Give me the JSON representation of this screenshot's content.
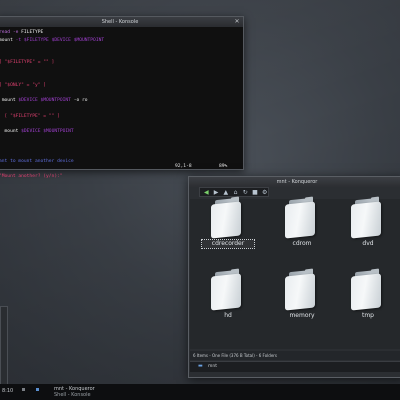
{
  "konsole": {
    "title": "Shell - Konsole",
    "lines": [
      [
        {
          "t": "read -e ",
          "c": "c-kw"
        },
        {
          "t": "FILETYPE",
          "c": "c-w"
        }
      ],
      [
        {
          "t": "mount ",
          "c": "c-w"
        },
        {
          "t": "-t $FILETYPE $DEVICE $MOUNTPOINT",
          "c": "c-var"
        }
      ],
      [],
      [],
      [
        {
          "t": "[ \"$FILETYPE\" = \"\" ]",
          "c": "c-str"
        }
      ],
      [],
      [],
      [
        {
          "t": "[ \"$ONLY\" = \"y\" ]",
          "c": "c-str"
        }
      ],
      [],
      [
        {
          "t": " mount ",
          "c": "c-w"
        },
        {
          "t": "$DEVICE $MOUNTPOINT",
          "c": "c-var"
        },
        {
          "t": " -o ro",
          "c": "c-w"
        }
      ],
      [],
      [
        {
          "t": "  [ \"$FILETYPE\" = \"\" ]",
          "c": "c-str"
        }
      ],
      [],
      [
        {
          "t": "  mount ",
          "c": "c-w"
        },
        {
          "t": "$DEVICE $MOUNTPOINT",
          "c": "c-var"
        }
      ],
      [],
      [],
      [],
      [
        {
          "t": "ant to mount another device",
          "c": "c-cmt"
        }
      ],
      [],
      [
        {
          "t": "\"Mount another? (y/n):\"",
          "c": "c-str"
        }
      ]
    ],
    "cursor_pos": "92,1-8",
    "scroll_pct": "89%"
  },
  "konqueror": {
    "title": "mnt - Konqueror",
    "folders": [
      {
        "name": "cdrecorder",
        "selected": true
      },
      {
        "name": "cdrom",
        "selected": false
      },
      {
        "name": "dvd",
        "selected": false
      },
      {
        "name": "hd",
        "selected": false
      },
      {
        "name": "memory",
        "selected": false
      },
      {
        "name": "tmp",
        "selected": false
      }
    ],
    "status": "6 Items - One File (376 B Total) - 6 Folders",
    "location": "mnt",
    "toolbar_icons": [
      "back-icon",
      "forward-icon",
      "up-icon",
      "home-icon",
      "reload-icon",
      "stop-icon",
      "gear-icon"
    ]
  },
  "taskbar": {
    "clock": "8:10",
    "tasks": [
      "mnt - Konqueror",
      "Shell - Konsole"
    ]
  }
}
